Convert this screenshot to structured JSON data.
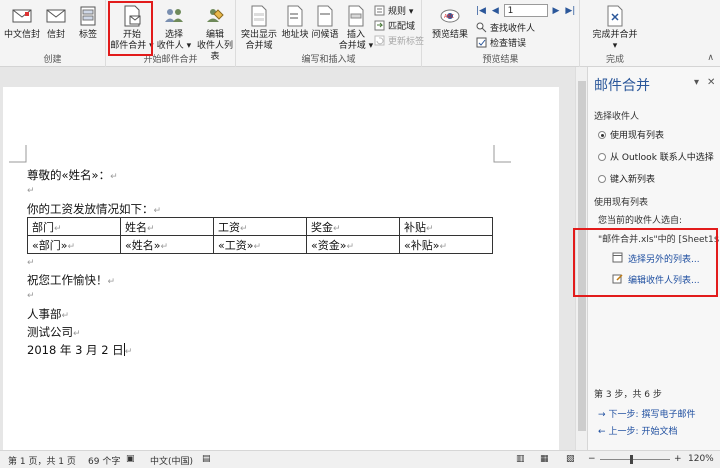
{
  "ribbon": {
    "group_create": {
      "label": "创建",
      "chinese_envelope": "中文信封",
      "envelope": "信封",
      "labels": "标签"
    },
    "group_start": {
      "label": "开始邮件合并",
      "start_mail_merge_line1": "开始",
      "start_mail_merge_line2": "邮件合并",
      "select_recipients_line1": "选择",
      "select_recipients_line2": "收件人",
      "edit_recipients_line1": "编辑",
      "edit_recipients_line2": "收件人列表"
    },
    "group_fields": {
      "label": "编写和插入域",
      "highlight_line1": "突出显示",
      "highlight_line2": "合并域",
      "address_block": "地址块",
      "greeting_line": "问候语",
      "insert_field_line1": "插入",
      "insert_field_line2": "合并域",
      "rules": "规则",
      "match_fields": "匹配域",
      "update_labels": "更新标签"
    },
    "group_preview": {
      "label": "预览结果",
      "preview_results": "预览结果",
      "record_number": "1",
      "find_recipient": "查找收件人",
      "check_errors": "检查错误"
    },
    "group_finish": {
      "label": "完成",
      "finish_merge": "完成并合并"
    }
  },
  "document": {
    "salutation": "尊敬的«姓名»：",
    "intro": "你的工资发放情况如下：",
    "table": {
      "headers": [
        "部门",
        "姓名",
        "工资",
        "奖金",
        "补贴"
      ],
      "fields": [
        "«部门»",
        "«姓名»",
        "«工资»",
        "«资金»",
        "«补贴»"
      ]
    },
    "wish": "祝您工作愉快！",
    "dept": "人事部",
    "company": "测试公司",
    "date": "2018 年 3 月 2 日"
  },
  "pane": {
    "title": "邮件合并",
    "select_recipients_heading": "选择收件人",
    "options": [
      {
        "label": "使用现有列表",
        "selected": true
      },
      {
        "label": "从 Outlook 联系人中选择",
        "selected": false
      },
      {
        "label": "键入新列表",
        "selected": false
      }
    ],
    "use_existing_heading": "使用现有列表",
    "current_source_label": "您当前的收件人选自:",
    "current_source": "\"邮件合并.xls\"中的 [Sheet1$]",
    "link_select_other": "选择另外的列表...",
    "link_edit_list": "编辑收件人列表...",
    "step": "第 3 步，共 6 步",
    "next_step": "下一步: 撰写电子邮件",
    "prev_step": "上一步: 开始文档"
  },
  "status": {
    "page": "第 1 页，共 1 页",
    "words": "69 个字",
    "language": "中文(中国)",
    "zoom": "120%"
  },
  "colors": {
    "highlight_box": "#e21b1b",
    "link": "#1f4fa0",
    "pane_title": "#2b579a"
  }
}
